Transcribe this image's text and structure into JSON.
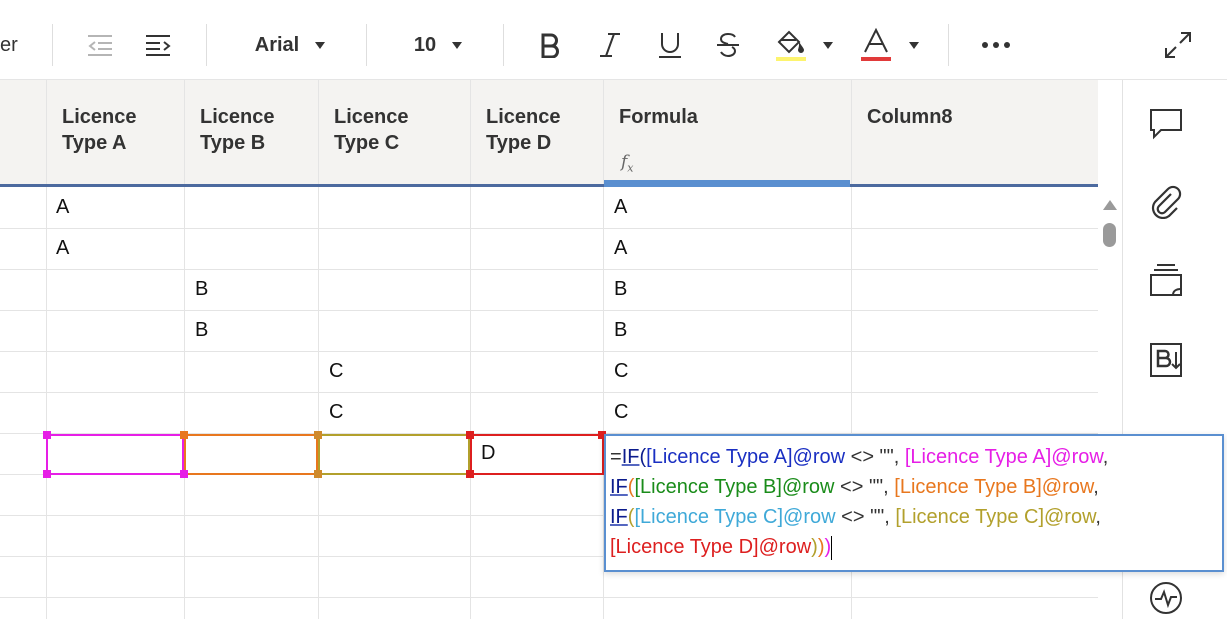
{
  "toolbar": {
    "cut_label": "er",
    "font": "Arial",
    "font_size": "10",
    "icons": [
      "outdent-icon",
      "indent-icon",
      "bold-icon",
      "italic-icon",
      "underline-icon",
      "strikethrough-icon",
      "fill-color-icon",
      "text-color-icon",
      "more-icon",
      "expand-icon"
    ],
    "fill_color": "#fdf46e",
    "text_color": "#e13a3a"
  },
  "columns": [
    {
      "label": "Licence\nType A"
    },
    {
      "label": "Licence\nType B"
    },
    {
      "label": "Licence\nType C"
    },
    {
      "label": "Licence\nType D"
    },
    {
      "label": "Formula",
      "icon": "fx-icon"
    },
    {
      "label": "Column8"
    }
  ],
  "rows": [
    [
      "A",
      "",
      "",
      "",
      "A",
      ""
    ],
    [
      "A",
      "",
      "",
      "",
      "A",
      ""
    ],
    [
      "",
      "B",
      "",
      "",
      "B",
      ""
    ],
    [
      "",
      "B",
      "",
      "",
      "B",
      ""
    ],
    [
      "",
      "",
      "C",
      "",
      "C",
      ""
    ],
    [
      "",
      "",
      "C",
      "",
      "C",
      ""
    ],
    [
      "",
      "",
      "",
      "D",
      "",
      ""
    ]
  ],
  "formula": {
    "line1": {
      "a": "=",
      "b": "IF",
      "c": "(",
      "d": "[Licence Type A]@row",
      "e": " <> \"\", ",
      "f": "[Licence Type A]@row",
      "g": ","
    },
    "line2": {
      "a": "IF",
      "b": "(",
      "c": "[Licence Type B]@row",
      "d": " <> \"\", ",
      "e": "[Licence Type B]@row",
      "f": ","
    },
    "line3": {
      "a": "IF",
      "b": "(",
      "c": "[Licence Type C]@row",
      "d": " <> \"\", ",
      "e": "[Licence Type C]@row",
      "f": ","
    },
    "line4": {
      "a": "[Licence Type D]@row",
      "b": ")",
      "c": ")",
      "d": ")"
    }
  },
  "colors": {
    "ref_a": "#e61ee6",
    "ref_b": "#e8771e",
    "ref_c": "#b2a02c",
    "ref_d": "#dd1f1f",
    "selection": "#5a8fd0",
    "header_rule": "#4c6a9f"
  },
  "rail_icons": [
    "comment-icon",
    "attachment-icon",
    "cards-icon",
    "bulk-icon",
    "history-icon",
    "activity-icon"
  ]
}
